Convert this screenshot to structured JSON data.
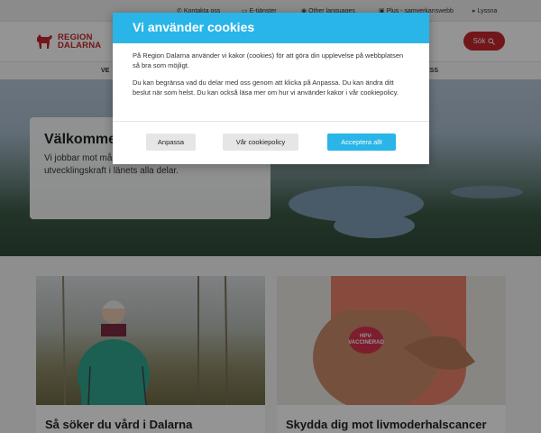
{
  "topbar": {
    "links": [
      {
        "label": "Kontakta oss",
        "icon": "phone-icon"
      },
      {
        "label": "E-tjänster",
        "icon": "monitor-icon"
      },
      {
        "label": "Other languages",
        "icon": "globe-icon"
      },
      {
        "label": "Plus - samverkanswebb",
        "icon": "lock-icon"
      },
      {
        "label": "Lyssna",
        "icon": "speaker-icon"
      }
    ]
  },
  "header": {
    "logo_line1": "REGION",
    "logo_line2": "DALARNA",
    "search_label": "Sök",
    "brand_color": "#c4262e"
  },
  "nav": {
    "items": [
      "VE",
      "ESS"
    ]
  },
  "hero": {
    "title": "Välkommen till Region Dalarna",
    "text": "Vi jobbar mot målet om ett hållbart Dalarna med utvecklingskraft i länets alla delar."
  },
  "cards": [
    {
      "title": "Så söker du vård i Dalarna"
    },
    {
      "title": "Skydda dig mot livmoderhalscancer",
      "badge": "HPV-VACCINERAD"
    }
  ],
  "cookie_dialog": {
    "title": "Vi använder cookies",
    "paragraph1": "På Region Dalarna använder vi kakor (cookies) för att göra din upplevelse på webbplatsen så bra som möjligt.",
    "paragraph2": "Du kan begränsa vad du delar med oss genom att klicka på Anpassa. Du kan ändra ditt beslut när som helst. Du kan också läsa mer om hur vi använder kakor i vår cookiepolicy.",
    "buttons": {
      "customize": "Anpassa",
      "policy": "Vår cookiepolicy",
      "accept": "Acceptera allt"
    },
    "accent_color": "#29b5e8"
  }
}
